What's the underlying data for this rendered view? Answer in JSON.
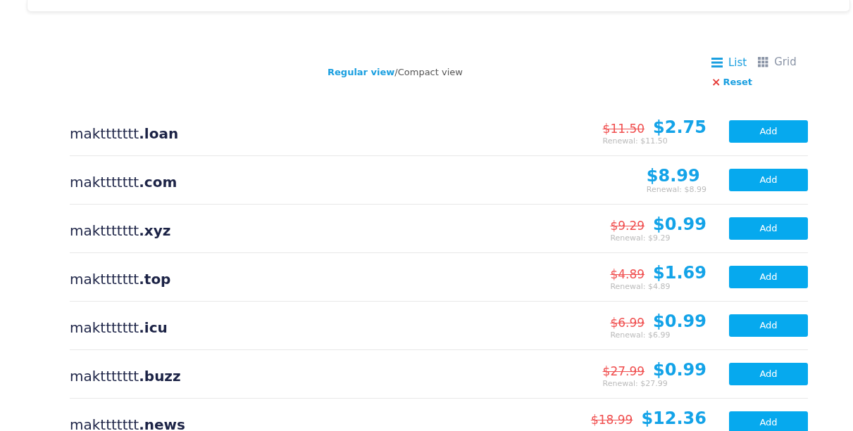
{
  "view_modes": [
    {
      "label": "Regular view",
      "selected": true
    },
    {
      "label": "Compact view",
      "selected": false
    }
  ],
  "view_separator": "/",
  "layouts": [
    {
      "label": "List",
      "kind": "list",
      "selected": true
    },
    {
      "label": "Grid",
      "kind": "grid",
      "selected": false
    }
  ],
  "reset": {
    "icon": "×",
    "label": "Reset"
  },
  "domains": [
    {
      "name": "makttttttt",
      "tld": ".loan",
      "old_price": "$11.50",
      "price": "$2.75",
      "renewal": "Renewal: $11.50",
      "button": "Add"
    },
    {
      "name": "makttttttt",
      "tld": ".com",
      "price": "$8.99",
      "renewal": "Renewal: $8.99",
      "button": "Add"
    },
    {
      "name": "makttttttt",
      "tld": ".xyz",
      "old_price": "$9.29",
      "price": "$0.99",
      "renewal": "Renewal: $9.29",
      "button": "Add"
    },
    {
      "name": "makttttttt",
      "tld": ".top",
      "old_price": "$4.89",
      "price": "$1.69",
      "renewal": "Renewal: $4.89",
      "button": "Add"
    },
    {
      "name": "makttttttt",
      "tld": ".icu",
      "old_price": "$6.99",
      "price": "$0.99",
      "renewal": "Renewal: $6.99",
      "button": "Add"
    },
    {
      "name": "makttttttt",
      "tld": ".buzz",
      "old_price": "$27.99",
      "price": "$0.99",
      "renewal": "Renewal: $27.99",
      "button": "Add"
    },
    {
      "name": "makttttttt",
      "tld": ".news",
      "old_price": "$18.99",
      "price": "$12.36",
      "button": "Add"
    }
  ]
}
